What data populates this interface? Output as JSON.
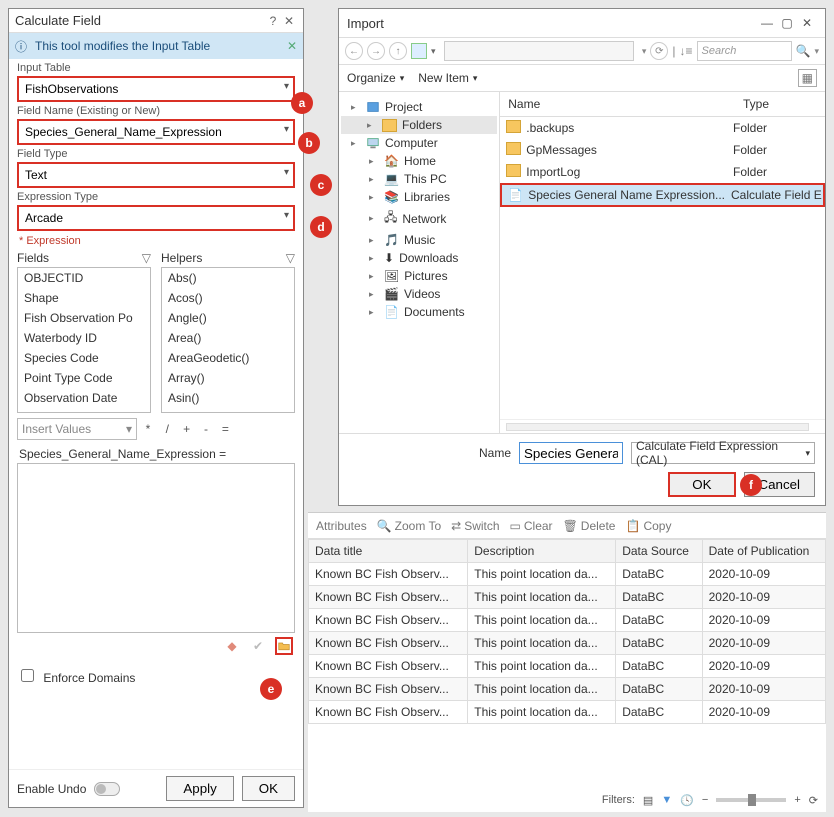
{
  "calc": {
    "title": "Calculate Field",
    "info": "This tool modifies the Input Table",
    "labels": {
      "input_table": "Input Table",
      "field_name": "Field Name (Existing or New)",
      "field_type": "Field Type",
      "expr_type": "Expression Type",
      "expression": "Expression",
      "fields": "Fields",
      "helpers": "Helpers",
      "insert_values": "Insert Values",
      "enforce": "Enforce Domains",
      "undo": "Enable Undo",
      "apply": "Apply",
      "ok": "OK"
    },
    "values": {
      "input_table": "FishObservations",
      "field_name": "Species_General_Name_Expression",
      "field_type": "Text",
      "expr_type": "Arcade",
      "expr_header": "Species_General_Name_Expression ="
    },
    "fields_list": [
      "OBJECTID",
      "Shape",
      "Fish Observation Po",
      "Waterbody ID",
      "Species Code",
      "Point Type Code",
      "Observation Date"
    ],
    "helpers_list": [
      "Abs()",
      "Acos()",
      "Angle()",
      "Area()",
      "AreaGeodetic()",
      "Array()",
      "Asin()"
    ],
    "ops": [
      "*",
      "/",
      "+",
      "-",
      "="
    ]
  },
  "import": {
    "title": "Import",
    "search_placeholder": "Search",
    "organize": "Organize",
    "new_item": "New Item",
    "tree": {
      "project": "Project",
      "folders": "Folders",
      "computer": "Computer",
      "nodes": [
        "Home",
        "This PC",
        "Libraries",
        "Network",
        "Music",
        "Downloads",
        "Pictures",
        "Videos",
        "Documents"
      ]
    },
    "cols": {
      "name": "Name",
      "type": "Type"
    },
    "rows": [
      {
        "name": ".backups",
        "type": "Folder",
        "kind": "folder"
      },
      {
        "name": "GpMessages",
        "type": "Folder",
        "kind": "folder"
      },
      {
        "name": "ImportLog",
        "type": "Folder",
        "kind": "folder"
      },
      {
        "name": "Species General Name Expression...",
        "type": "Calculate Field E",
        "kind": "file"
      }
    ],
    "footer": {
      "name_label": "Name",
      "name_value": "Species General N",
      "filter": "Calculate Field Expression (CAL)",
      "ok": "OK",
      "cancel": "Cancel"
    }
  },
  "attr": {
    "toolbar": {
      "attributes": "Attributes",
      "zoom": "Zoom To",
      "switch": "Switch",
      "clear": "Clear",
      "delete": "Delete",
      "copy": "Copy"
    },
    "cols": [
      "Data title",
      "Description",
      "Data Source",
      "Date of Publication"
    ],
    "rows": [
      [
        "Known BC Fish Observ...",
        "This point location da...",
        "DataBC",
        "2020-10-09"
      ],
      [
        "Known BC Fish Observ...",
        "This point location da...",
        "DataBC",
        "2020-10-09"
      ],
      [
        "Known BC Fish Observ...",
        "This point location da...",
        "DataBC",
        "2020-10-09"
      ],
      [
        "Known BC Fish Observ...",
        "This point location da...",
        "DataBC",
        "2020-10-09"
      ],
      [
        "Known BC Fish Observ...",
        "This point location da...",
        "DataBC",
        "2020-10-09"
      ],
      [
        "Known BC Fish Observ...",
        "This point location da...",
        "DataBC",
        "2020-10-09"
      ],
      [
        "Known BC Fish Observ...",
        "This point location da...",
        "DataBC",
        "2020-10-09"
      ]
    ],
    "filters_label": "Filters:"
  },
  "badges": {
    "a": "a",
    "b": "b",
    "c": "c",
    "d": "d",
    "e": "e",
    "f": "f"
  }
}
